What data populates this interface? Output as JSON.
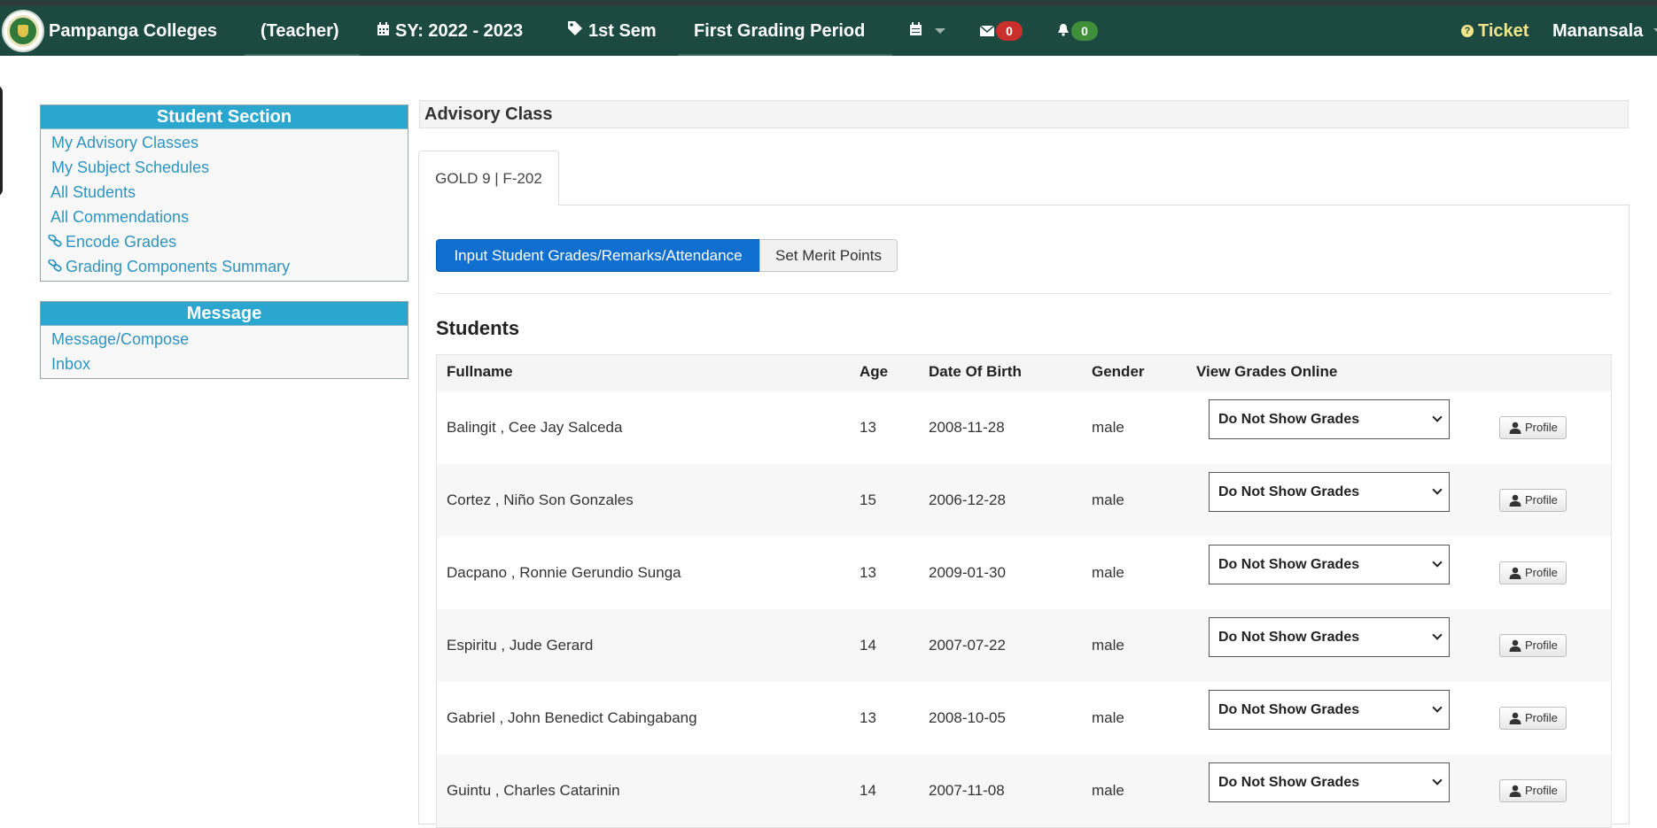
{
  "navbar": {
    "brand": "Pampanga Colleges",
    "role": "(Teacher)",
    "school_year": "SY: 2022 - 2023",
    "semester": "1st Sem",
    "grading_period": "First Grading Period",
    "messages_count": "0",
    "notifications_count": "0",
    "ticket_label": "Ticket",
    "user_name": "Manansala"
  },
  "sidebar": {
    "student_section": {
      "title": "Student Section",
      "items": [
        {
          "label": "My Advisory Classes",
          "icon": ""
        },
        {
          "label": "My Subject Schedules",
          "icon": ""
        },
        {
          "label": "All Students",
          "icon": ""
        },
        {
          "label": "All Commendations",
          "icon": ""
        },
        {
          "label": "Encode Grades",
          "icon": "link-icon"
        },
        {
          "label": "Grading Components Summary",
          "icon": "link-icon"
        }
      ]
    },
    "message_section": {
      "title": "Message",
      "items": [
        {
          "label": "Message/Compose"
        },
        {
          "label": "Inbox"
        }
      ]
    }
  },
  "main": {
    "title": "Advisory Class",
    "tab_label": "GOLD 9 | F-202",
    "btn_input_grades": "Input Student Grades/Remarks/Attendance",
    "btn_merit_points": "Set Merit Points",
    "students_heading": "Students",
    "table": {
      "headers": [
        "Fullname",
        "Age",
        "Date Of Birth",
        "Gender",
        "View Grades Online"
      ],
      "select_value": "Do Not Show Grades",
      "profile_label": "Profile",
      "rows": [
        {
          "name": "Balingit , Cee Jay Salceda",
          "age": "13",
          "dob": "2008-11-28",
          "gender": "male"
        },
        {
          "name": "Cortez , Niño Son Gonzales",
          "age": "15",
          "dob": "2006-12-28",
          "gender": "male"
        },
        {
          "name": "Dacpano , Ronnie Gerundio Sunga",
          "age": "13",
          "dob": "2009-01-30",
          "gender": "male"
        },
        {
          "name": "Espiritu , Jude Gerard",
          "age": "14",
          "dob": "2007-07-22",
          "gender": "male"
        },
        {
          "name": "Gabriel , John Benedict Cabingabang",
          "age": "13",
          "dob": "2008-10-05",
          "gender": "male"
        },
        {
          "name": "Guintu , Charles Catarinin",
          "age": "14",
          "dob": "2007-11-08",
          "gender": "male"
        }
      ]
    }
  },
  "colors": {
    "navbar": "#1d4a40",
    "panel_header": "#2aa6cf",
    "link": "#2f94c0",
    "primary_button": "#0f6fd0",
    "badge_messages": "#c9302c",
    "badge_notifications": "#3f8f3a"
  }
}
